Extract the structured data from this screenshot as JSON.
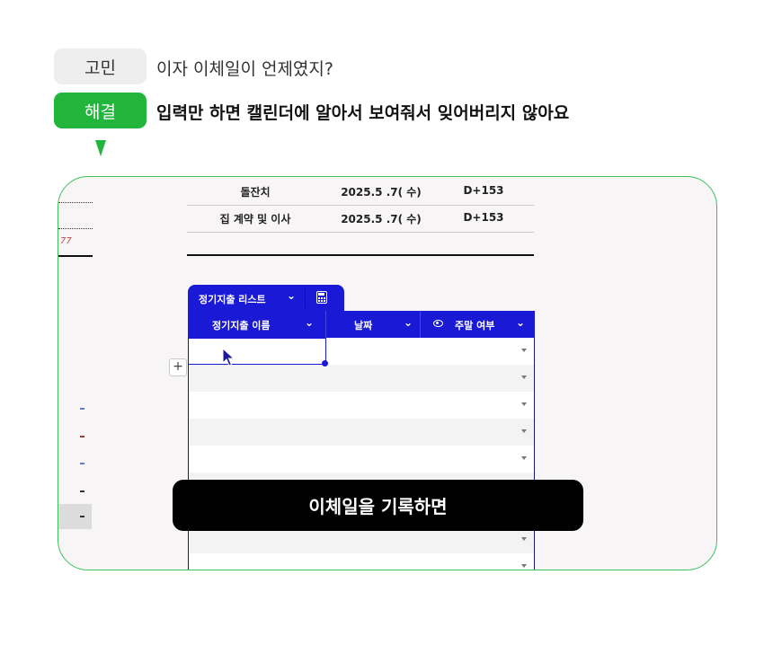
{
  "problem": {
    "tag": "고민",
    "text": "이자 이체일이 언제였지?"
  },
  "solution": {
    "tag": "해결",
    "text": "입력만 하면 캘린더에 알아서 보여줘서 잊어버리지 않아요"
  },
  "left_panel": {
    "number": "77"
  },
  "summary_rows": [
    {
      "name": "돌잔치",
      "date": "2025.5 .7( 수)",
      "dday": "D+153"
    },
    {
      "name": "집 계약 및 이사",
      "date": "2025.5 .7( 수)",
      "dday": "D+153"
    }
  ],
  "table": {
    "tab_label": "정기지출 리스트",
    "columns": [
      "정기지출 이름",
      "날짜",
      "주말 여부"
    ],
    "add_row_label": "+"
  },
  "caption": "이체일을 기록하면",
  "colors": {
    "accent_green": "#21b53c",
    "table_blue": "#1a1ad6",
    "caption_bg": "#000000"
  },
  "icons": [
    "chevron-down-icon",
    "calculator-icon",
    "eye-icon",
    "mouse-cursor-icon",
    "plus-icon",
    "dropdown-caret-icon"
  ]
}
